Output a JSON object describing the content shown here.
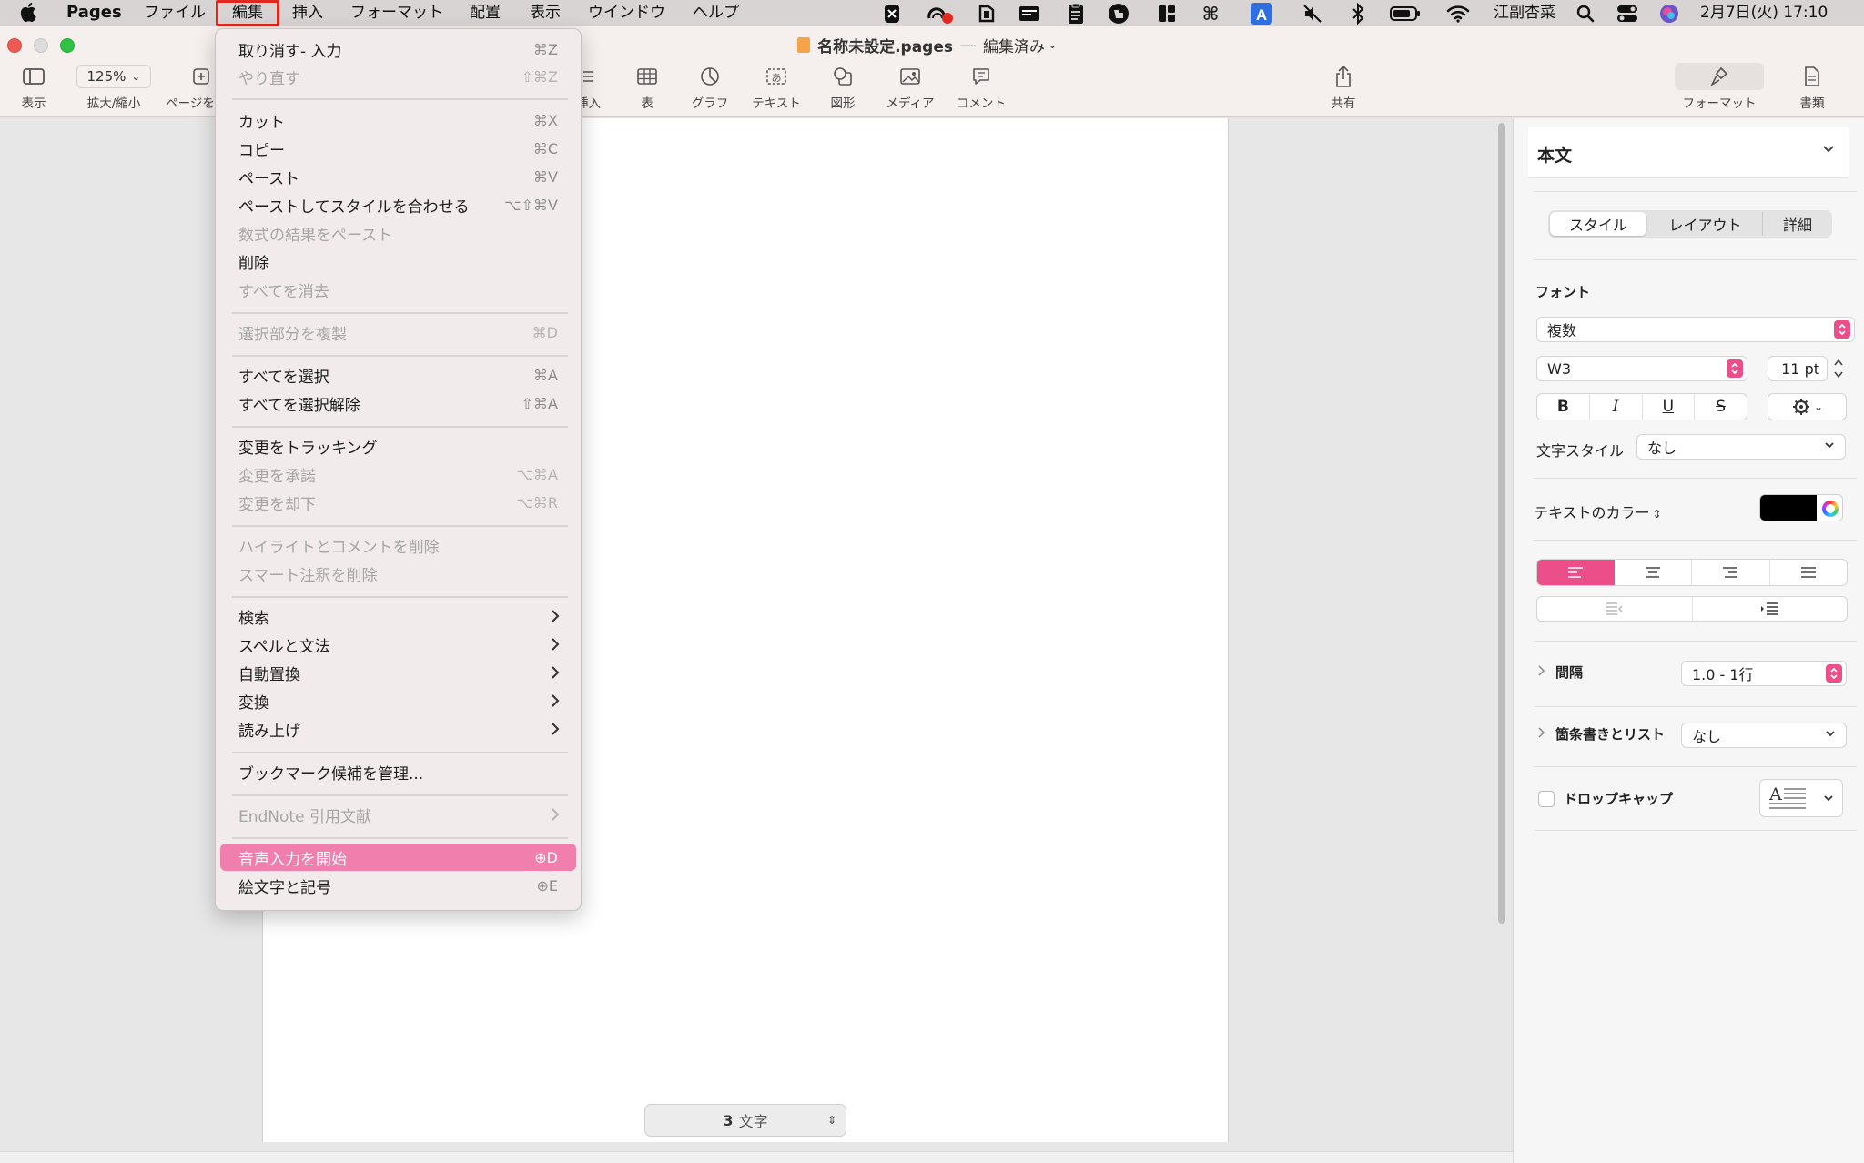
{
  "menubar": {
    "app": "Pages",
    "items": [
      "ファイル",
      "編集",
      "挿入",
      "フォーマット",
      "配置",
      "表示",
      "ウインドウ",
      "ヘルプ"
    ],
    "user": "江副杏菜",
    "datetime": "2月7日(火) 17:10"
  },
  "window": {
    "title": "名称未設定.pages",
    "title_sep": "—",
    "status": "編集済み",
    "zoom": "125%",
    "toolbar": {
      "view": "表示",
      "zoom": "拡大/縮小",
      "add_page": "ページを",
      "insert": "挿入",
      "table": "表",
      "chart": "グラフ",
      "text": "テキスト",
      "shape": "図形",
      "media": "メディア",
      "comment": "コメント",
      "share": "共有",
      "format": "フォーマット",
      "document": "書類"
    }
  },
  "edit_menu": {
    "undo": {
      "label": "取り消す- 入力",
      "shortcut": "⌘Z"
    },
    "redo": {
      "label": "やり直す",
      "shortcut": "⇧⌘Z"
    },
    "cut": {
      "label": "カット",
      "shortcut": "⌘X"
    },
    "copy": {
      "label": "コピー",
      "shortcut": "⌘C"
    },
    "paste": {
      "label": "ペースト",
      "shortcut": "⌘V"
    },
    "paste_match": {
      "label": "ペーストしてスタイルを合わせる",
      "shortcut": "⌥⇧⌘V"
    },
    "paste_formula": {
      "label": "数式の結果をペースト"
    },
    "delete": {
      "label": "削除"
    },
    "clear_all": {
      "label": "すべてを消去"
    },
    "duplicate": {
      "label": "選択部分を複製",
      "shortcut": "⌘D"
    },
    "select_all": {
      "label": "すべてを選択",
      "shortcut": "⌘A"
    },
    "deselect_all": {
      "label": "すべてを選択解除",
      "shortcut": "⇧⌘A"
    },
    "track_changes": {
      "label": "変更をトラッキング"
    },
    "accept_change": {
      "label": "変更を承諾",
      "shortcut": "⌥⌘A"
    },
    "reject_change": {
      "label": "変更を却下",
      "shortcut": "⌥⌘R"
    },
    "remove_highlights": {
      "label": "ハイライトとコメントを削除"
    },
    "remove_smart_annotations": {
      "label": "スマート注釈を削除"
    },
    "find": {
      "label": "検索"
    },
    "spelling": {
      "label": "スペルと文法"
    },
    "substitutions": {
      "label": "自動置換"
    },
    "transformations": {
      "label": "変換"
    },
    "speech": {
      "label": "読み上げ"
    },
    "bookmarks": {
      "label": "ブックマーク候補を管理..."
    },
    "endnote": {
      "label": "EndNote 引用文献"
    },
    "dictation": {
      "label": "音声入力を開始",
      "shortcut": "D"
    },
    "emoji": {
      "label": "絵文字と記号",
      "shortcut": "E"
    }
  },
  "word_count": {
    "count": "3",
    "unit": "文字"
  },
  "format_panel": {
    "paragraph_style": "本文",
    "tabs": [
      "スタイル",
      "レイアウト",
      "詳細"
    ],
    "font_heading": "フォント",
    "font_family": "複数",
    "font_weight": "W3",
    "font_size": "11 pt",
    "style_buttons": [
      "B",
      "I",
      "U",
      "S"
    ],
    "char_style_label": "文字スタイル",
    "char_style_value": "なし",
    "text_color_label": "テキストのカラー",
    "spacing_label": "間隔",
    "spacing_value": "1.0 - 1行",
    "bullets_label": "箇条書きとリスト",
    "bullets_value": "なし",
    "dropcap_label": "ドロップキャップ",
    "accent": "#ec4e89"
  }
}
